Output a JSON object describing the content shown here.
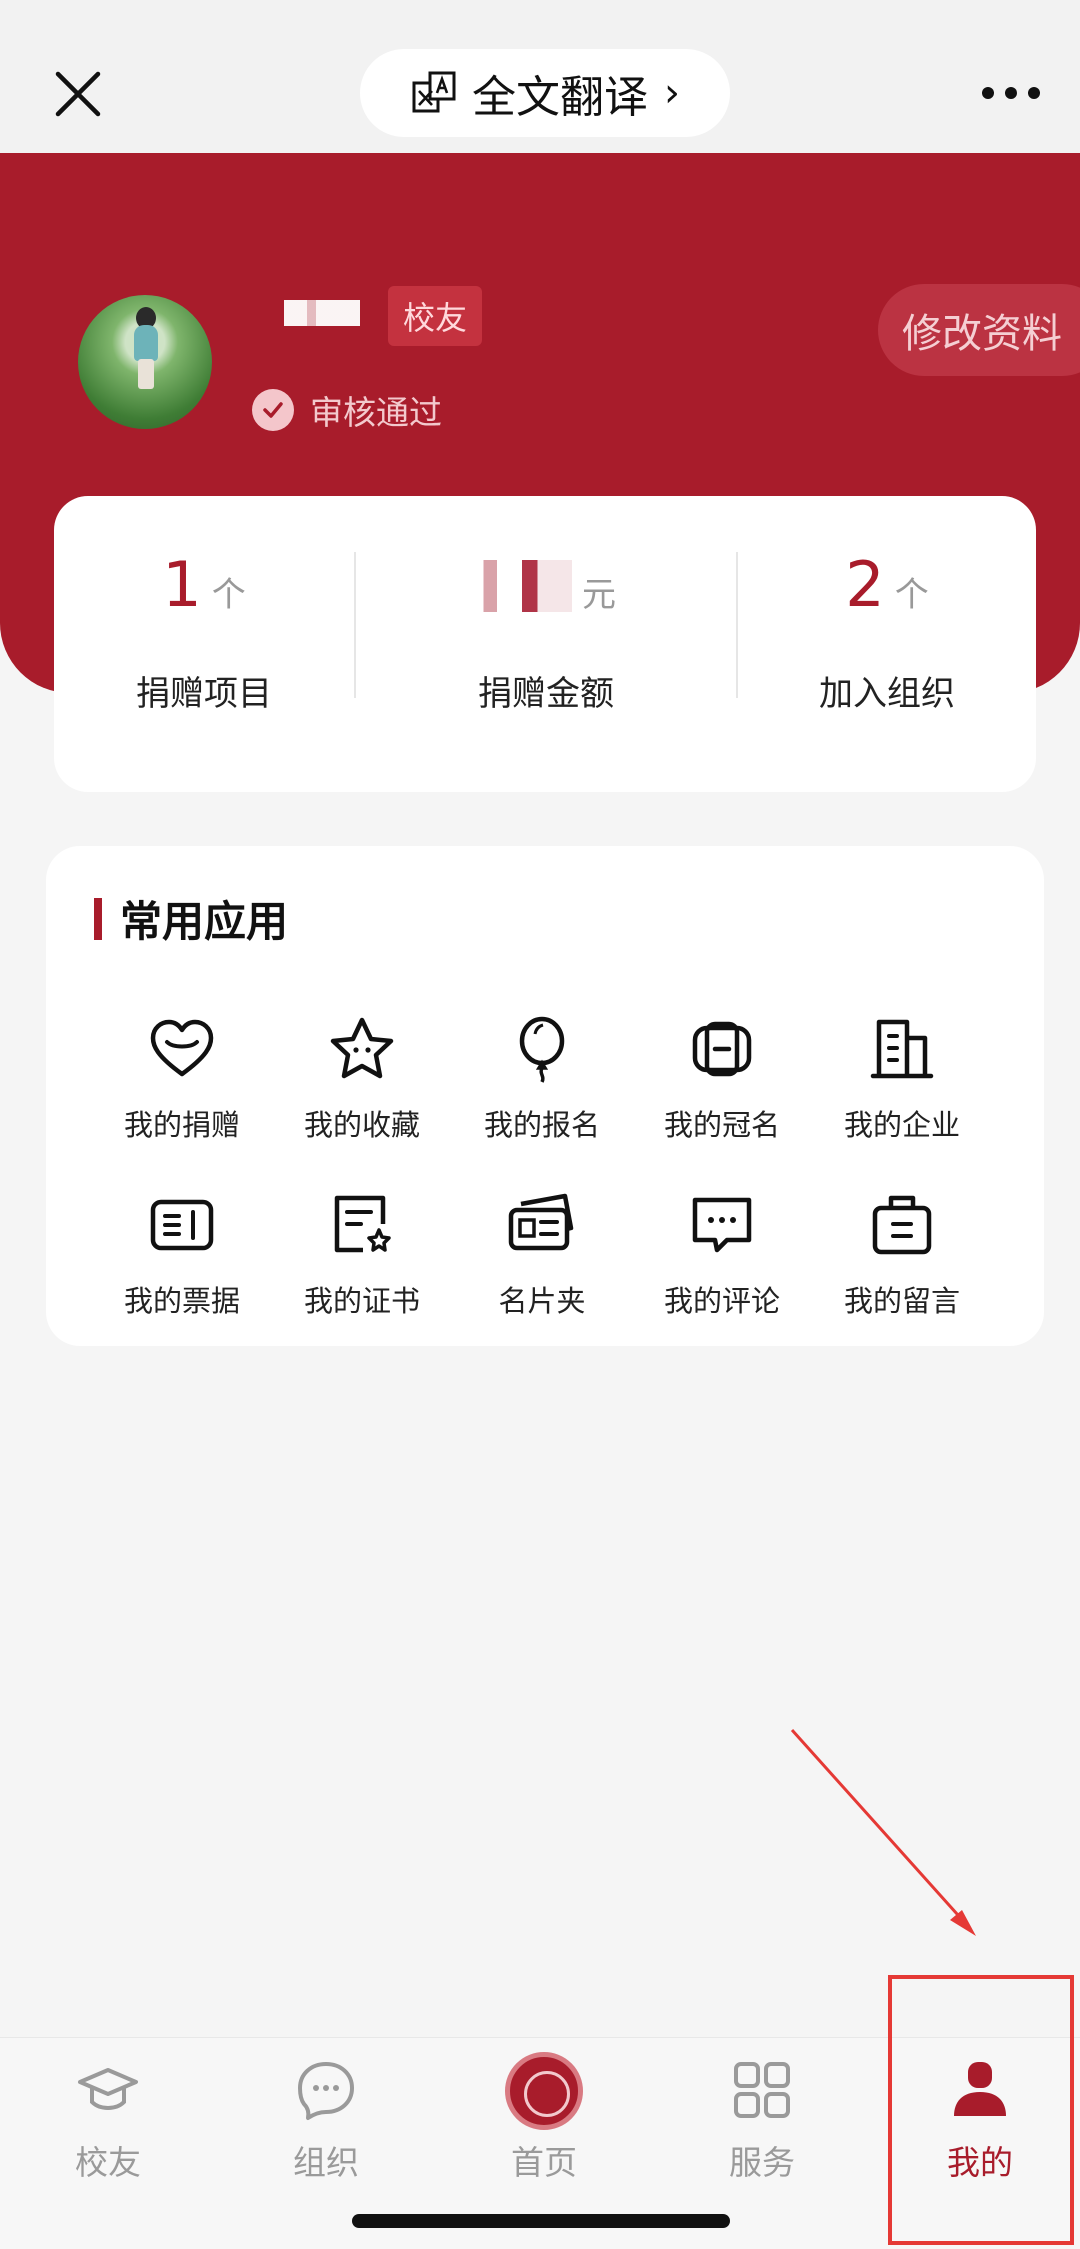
{
  "topbar": {
    "translate_label": "全文翻译",
    "translate_chevron": "›"
  },
  "profile": {
    "badge": "校友",
    "status": "审核通过",
    "edit_label": "修改资料"
  },
  "stats": [
    {
      "value": "1",
      "unit": "个",
      "label": "捐赠项目"
    },
    {
      "value": "",
      "unit": "元",
      "label": "捐赠金额"
    },
    {
      "value": "2",
      "unit": "个",
      "label": "加入组织"
    }
  ],
  "apps": {
    "title": "常用应用",
    "items": [
      {
        "label": "我的捐赠",
        "icon": "heart-icon"
      },
      {
        "label": "我的收藏",
        "icon": "star-icon"
      },
      {
        "label": "我的报名",
        "icon": "balloon-icon"
      },
      {
        "label": "我的冠名",
        "icon": "badge-icon"
      },
      {
        "label": "我的企业",
        "icon": "building-icon"
      },
      {
        "label": "我的票据",
        "icon": "receipt-icon"
      },
      {
        "label": "我的证书",
        "icon": "certificate-icon"
      },
      {
        "label": "名片夹",
        "icon": "card-holder-icon"
      },
      {
        "label": "我的评论",
        "icon": "comment-icon"
      },
      {
        "label": "我的留言",
        "icon": "message-bag-icon"
      }
    ]
  },
  "nav": [
    {
      "label": "校友",
      "icon": "graduation-cap-icon"
    },
    {
      "label": "组织",
      "icon": "chat-bubble-icon"
    },
    {
      "label": "首页",
      "icon": "university-logo-icon"
    },
    {
      "label": "服务",
      "icon": "grid-icon"
    },
    {
      "label": "我的",
      "icon": "user-icon"
    }
  ],
  "colors": {
    "brand": "#a81c2b",
    "annotation": "#e53935"
  }
}
